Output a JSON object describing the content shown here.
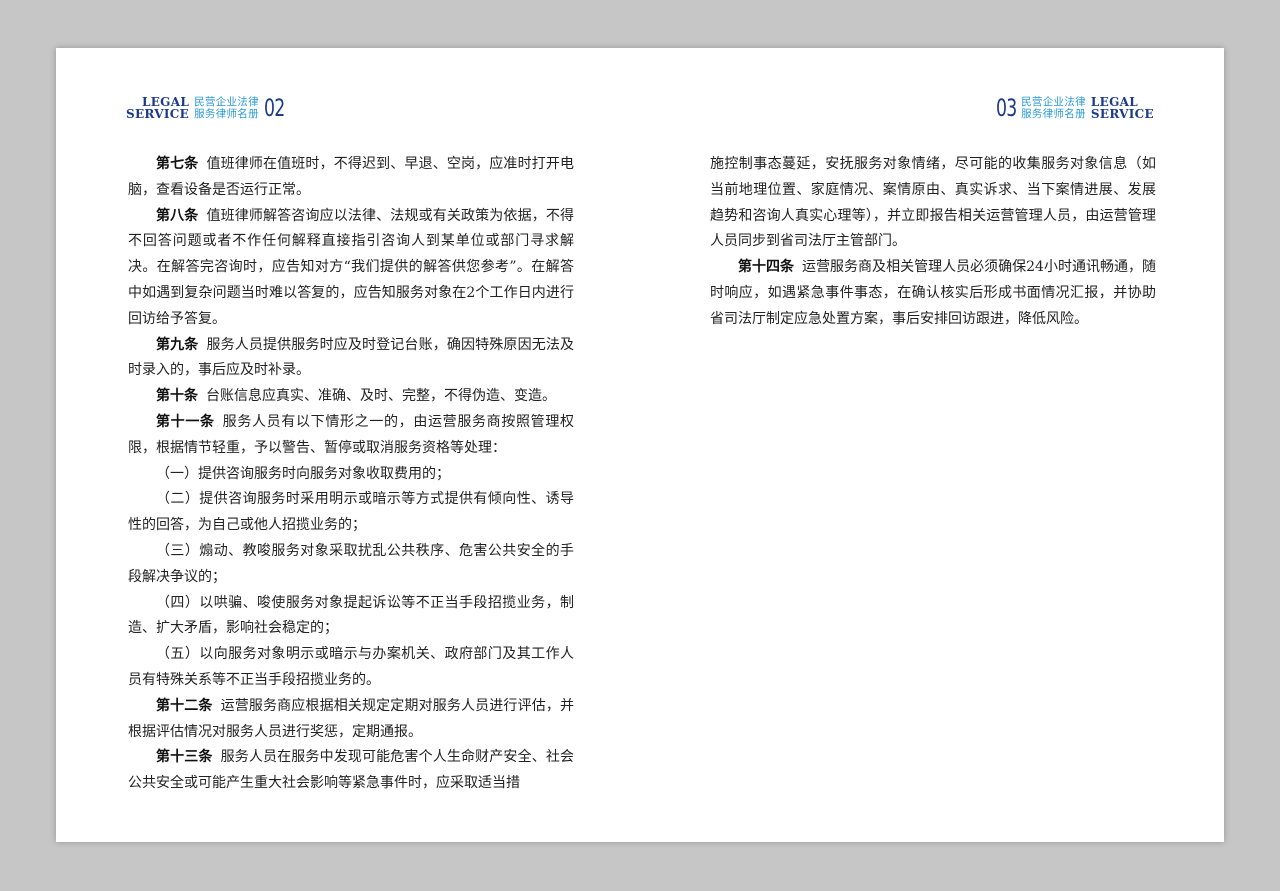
{
  "left_page": {
    "header": {
      "legal_line1": "LEGAL",
      "legal_line2": "SERVICE",
      "title_line1": "民营企业法律",
      "title_line2": "服务律师名册",
      "page_number": "02"
    },
    "paragraphs": [
      {
        "article": "第七条",
        "text": "值班律师在值班时，不得迟到、早退、空岗，应准时打开电脑，查看设备是否运行正常。"
      },
      {
        "article": "第八条",
        "text": "值班律师解答咨询应以法律、法规或有关政策为依据，不得不回答问题或者不作任何解释直接指引咨询人到某单位或部门寻求解决。在解答完咨询时，应告知对方“我们提供的解答供您参考”。在解答中如遇到复杂问题当时难以答复的，应告知服务对象在2个工作日内进行回访给予答复。"
      },
      {
        "article": "第九条",
        "text": "服务人员提供服务时应及时登记台账，确因特殊原因无法及时录入的，事后应及时补录。"
      },
      {
        "article": "第十条",
        "text": "台账信息应真实、准确、及时、完整，不得伪造、变造。"
      },
      {
        "article": "第十一条",
        "text": "服务人员有以下情形之一的，由运营服务商按照管理权限，根据情节轻重，予以警告、暂停或取消服务资格等处理："
      },
      {
        "article": "",
        "text": "（一）提供咨询服务时向服务对象收取费用的；"
      },
      {
        "article": "",
        "text": "（二）提供咨询服务时采用明示或暗示等方式提供有倾向性、诱导性的回答，为自己或他人招揽业务的；"
      },
      {
        "article": "",
        "text": "（三）煽动、教唆服务对象采取扰乱公共秩序、危害公共安全的手段解决争议的；"
      },
      {
        "article": "",
        "text": "（四）以哄骗、唆使服务对象提起诉讼等不正当手段招揽业务，制造、扩大矛盾，影响社会稳定的；"
      },
      {
        "article": "",
        "text": "（五）以向服务对象明示或暗示与办案机关、政府部门及其工作人员有特殊关系等不正当手段招揽业务的。"
      },
      {
        "article": "第十二条",
        "text": "运营服务商应根据相关规定定期对服务人员进行评估，并根据评估情况对服务人员进行奖惩，定期通报。"
      },
      {
        "article": "第十三条",
        "text": "服务人员在服务中发现可能危害个人生命财产安全、社会公共安全或可能产生重大社会影响等紧急事件时，应采取适当措"
      }
    ]
  },
  "right_page": {
    "header": {
      "page_number": "03",
      "title_line1": "民营企业法律",
      "title_line2": "服务律师名册",
      "legal_line1": "LEGAL",
      "legal_line2": "SERVICE"
    },
    "continuation": "施控制事态蔓延，安抚服务对象情绪，尽可能的收集服务对象信息（如当前地理位置、家庭情况、案情原由、真实诉求、当下案情进展、发展趋势和咨询人真实心理等），并立即报告相关运营管理人员，由运营管理人员同步到省司法厅主管部门。",
    "paragraphs": [
      {
        "article": "第十四条",
        "text": "运营服务商及相关管理人员必须确保24小时通讯畅通，随时响应，如遇紧急事件事态，在确认核实后形成书面情况汇报，并协助省司法厅制定应急处置方案，事后安排回访跟进，降低风险。"
      }
    ]
  }
}
